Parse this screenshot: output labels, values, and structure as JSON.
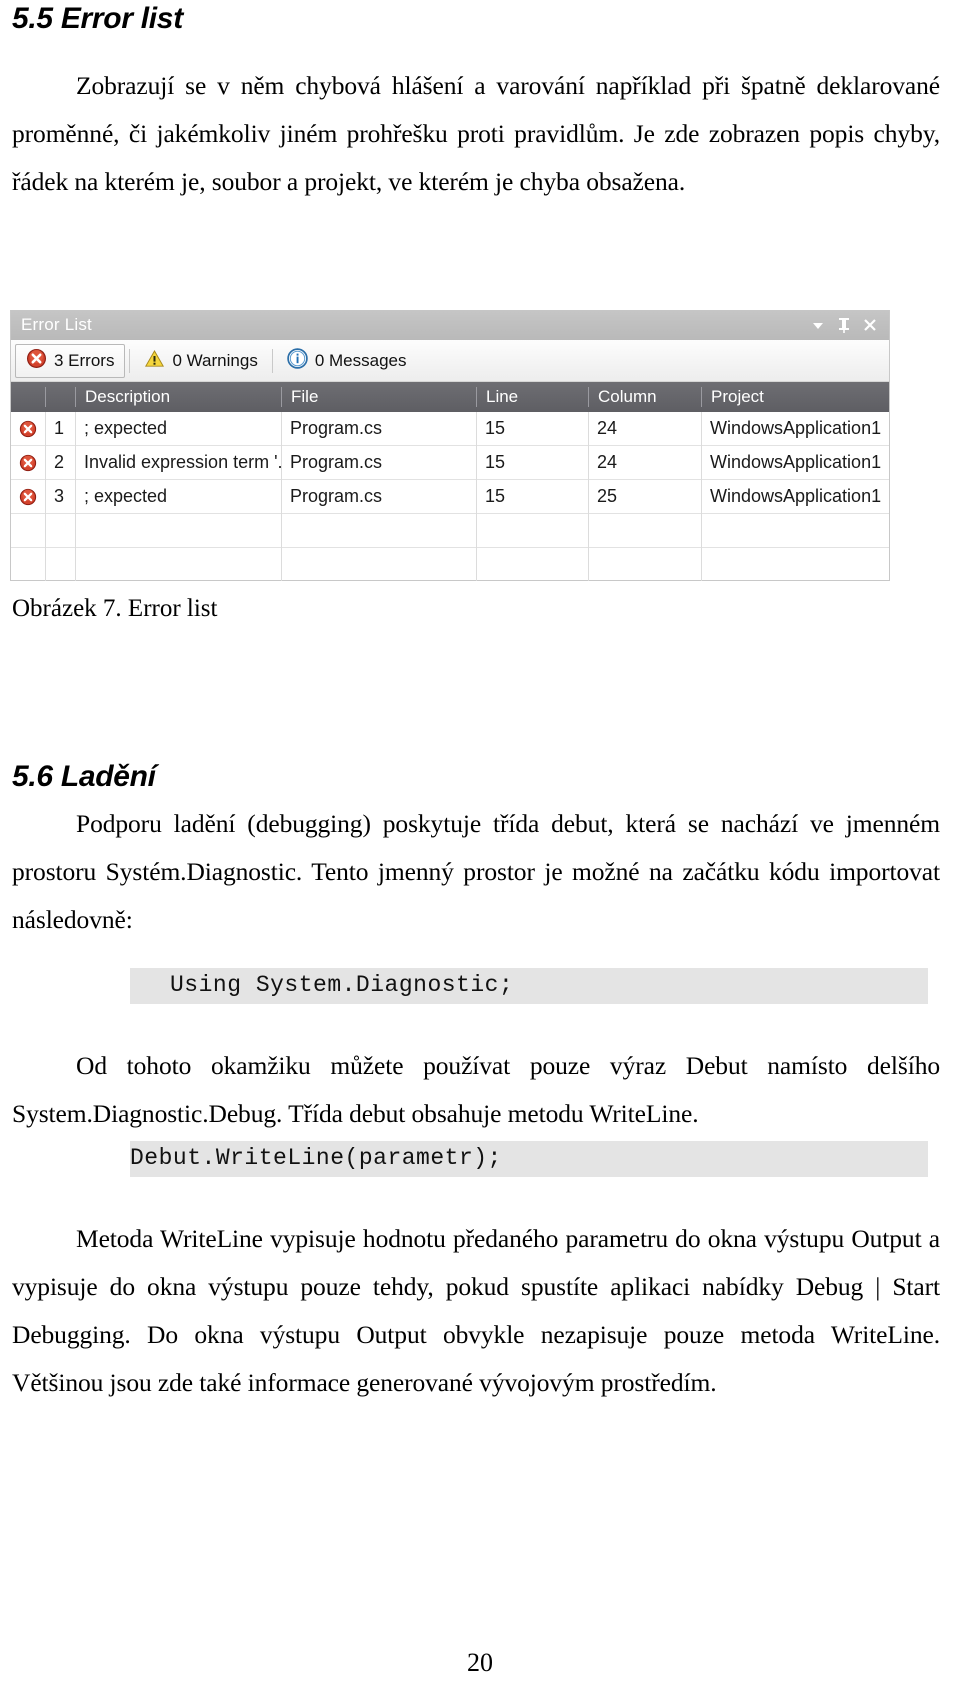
{
  "document": {
    "page_number": "20",
    "heading_55": "5.5 Error list",
    "heading_56": "5.6 Ladění",
    "paragraph_1": "Zobrazují se v něm chybová hlášení a varování například při špatně deklarované proměnné, či jakémkoliv jiném prohřešku proti pravidlům. Je zde zobrazen popis chyby, řádek na kterém je, soubor a projekt, ve kterém je chyba obsažena.",
    "figure_caption": "Obrázek 7. Error list",
    "paragraph_2": "Podporu ladění (debugging) poskytuje třída debut, která se nachází ve jmenném prostoru Systém.Diagnostic. Tento jmenný prostor je možné na začátku kódu importovat následovně:",
    "code_1": "Using System.Diagnostic;",
    "paragraph_3": "Od tohoto okamžiku můžete používat pouze výraz Debut namísto delšího System.Diagnostic.Debug. Třída debut obsahuje metodu WriteLine.",
    "code_2": "Debut.WriteLine(parametr);",
    "paragraph_4": "Metoda WriteLine vypisuje hodnotu předaného parametru do okna výstupu Output a  vypisuje do okna výstupu pouze tehdy, pokud spustíte aplikaci nabídky Debug | Start Debugging. Do okna výstupu Output obvykle nezapisuje pouze metoda WriteLine. Většinou jsou zde také informace generované vývojovým prostředím."
  },
  "error_list": {
    "title": "Error List",
    "window_buttons": [
      {
        "name": "dropdown-arrow",
        "glyph": "▼"
      },
      {
        "name": "pin",
        "glyph": "⊥"
      },
      {
        "name": "close",
        "glyph": "✕"
      }
    ],
    "toolbar": [
      {
        "icon": "error-icon",
        "label": "3 Errors",
        "active": true
      },
      {
        "icon": "warning-icon",
        "label": "0 Warnings",
        "active": false
      },
      {
        "icon": "info-icon",
        "label": "0 Messages",
        "active": false
      }
    ],
    "columns": [
      "",
      "",
      "Description",
      "File",
      "Line",
      "Column",
      "Project"
    ],
    "rows": [
      {
        "icon": "error-icon",
        "number": "1",
        "description": "; expected",
        "file": "Program.cs",
        "line": "15",
        "column": "24",
        "project": "WindowsApplication1"
      },
      {
        "icon": "error-icon",
        "number": "2",
        "description": "Invalid expression term '.'",
        "file": "Program.cs",
        "line": "15",
        "column": "24",
        "project": "WindowsApplication1"
      },
      {
        "icon": "error-icon",
        "number": "3",
        "description": "; expected",
        "file": "Program.cs",
        "line": "15",
        "column": "25",
        "project": "WindowsApplication1"
      }
    ],
    "colors": {
      "error_red": "#c63225",
      "warning_yellow": "#f2d32b",
      "info_blue": "#1f6fb5",
      "header_gray": "#63636a",
      "titlebar_gray": "#bfbfbf"
    }
  }
}
